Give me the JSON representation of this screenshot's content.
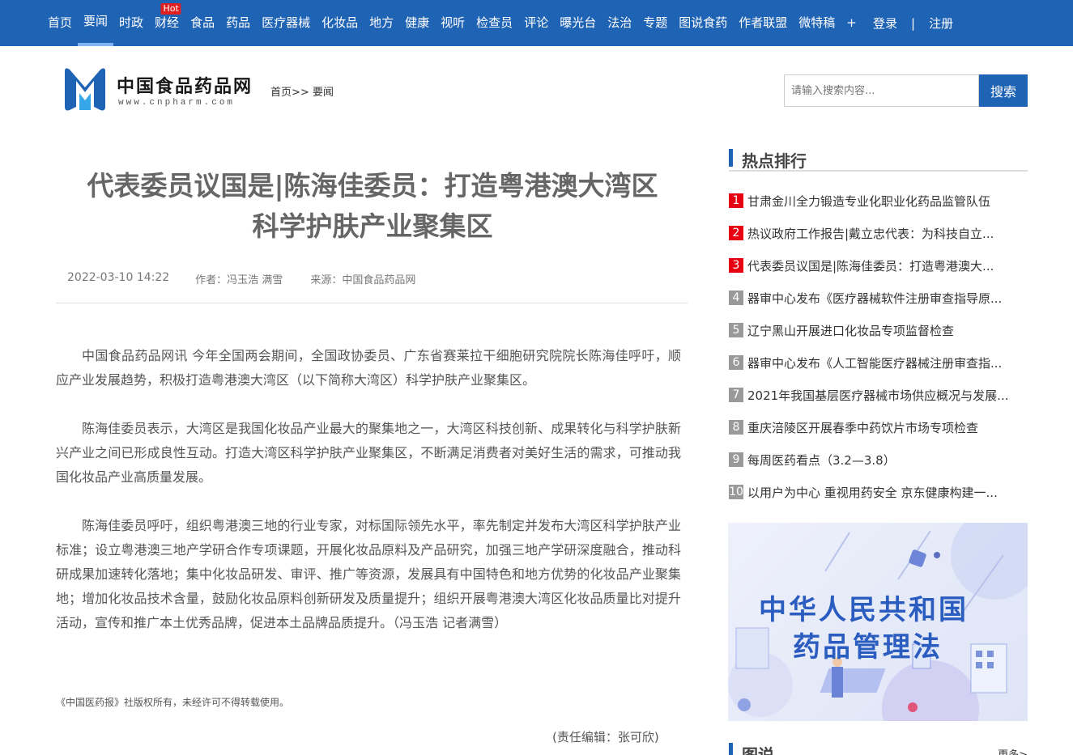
{
  "nav": {
    "items": [
      {
        "label": "首页"
      },
      {
        "label": "要闻"
      },
      {
        "label": "时政"
      },
      {
        "label": "财经"
      },
      {
        "label": "食品"
      },
      {
        "label": "药品"
      },
      {
        "label": "医疗器械"
      },
      {
        "label": "化妆品"
      },
      {
        "label": "地方"
      },
      {
        "label": "健康"
      },
      {
        "label": "视听"
      },
      {
        "label": "检查员"
      },
      {
        "label": "评论"
      },
      {
        "label": "曝光台"
      },
      {
        "label": "法治"
      },
      {
        "label": "专题"
      },
      {
        "label": "图说食药"
      },
      {
        "label": "作者联盟"
      },
      {
        "label": "微特稿"
      },
      {
        "label": "+"
      }
    ],
    "active_index": 1,
    "hot_badge": "Hot",
    "login": "登录",
    "separator": "|",
    "register": "注册"
  },
  "header": {
    "logo_text": "中国食品药品网",
    "logo_url": "www.cnpharm.com",
    "breadcrumb_home": "首页",
    "breadcrumb_sep": ">>",
    "breadcrumb_current": "要闻",
    "search_placeholder": "请输入搜索内容...",
    "search_button": "搜索"
  },
  "article": {
    "title_line1": "代表委员议国是|陈海佳委员：打造粤港澳大湾区",
    "title_line2": "科学护肤产业聚集区",
    "date": "2022-03-10 14:22",
    "author": "作者：冯玉浩 满雪",
    "source": "来源：中国食品药品网",
    "paragraphs": [
      "中国食品药品网讯 今年全国两会期间，全国政协委员、广东省赛莱拉干细胞研究院院长陈海佳呼吁，顺应产业发展趋势，积极打造粤港澳大湾区（以下简称大湾区）科学护肤产业聚集区。",
      "陈海佳委员表示，大湾区是我国化妆品产业最大的聚集地之一，大湾区科技创新、成果转化与科学护肤新兴产业之间已形成良性互动。打造大湾区科学护肤产业聚集区，不断满足消费者对美好生活的需求，可推动我国化妆品产业高质量发展。",
      "陈海佳委员呼吁，组织粤港澳三地的行业专家，对标国际领先水平，率先制定并发布大湾区科学护肤产业标准；设立粤港澳三地产学研合作专项课题，开展化妆品原料及产品研究，加强三地产学研深度融合，推动科研成果加速转化落地；集中化妆品研发、审评、推广等资源，发展具有中国特色和地方优势的化妆品产业聚集地；增加化妆品技术含量，鼓励化妆品原料创新研发及质量提升；组织开展粤港澳大湾区化妆品质量比对提升活动，宣传和推广本土优秀品牌，促进本土品牌品质提升。（冯玉浩 记者满雪）"
    ],
    "copyright": "《中国医药报》社版权所有，未经许可不得转载使用。",
    "editor": "(责任编辑：张可欣)"
  },
  "sidebar": {
    "hot_title": "热点排行",
    "hot_items": [
      {
        "num": "1",
        "text": "甘肃金川全力锻造专业化职业化药品监管队伍"
      },
      {
        "num": "2",
        "text": "热议政府工作报告|戴立忠代表：为科技自立..."
      },
      {
        "num": "3",
        "text": "代表委员议国是|陈海佳委员：打造粤港澳大..."
      },
      {
        "num": "4",
        "text": "器审中心发布《医疗器械软件注册审查指导原..."
      },
      {
        "num": "5",
        "text": "辽宁黑山开展进口化妆品专项监督检查"
      },
      {
        "num": "6",
        "text": "器审中心发布《人工智能医疗器械注册审查指..."
      },
      {
        "num": "7",
        "text": "2021年我国基层医疗器械市场供应概况与发展..."
      },
      {
        "num": "8",
        "text": "重庆涪陵区开展春季中药饮片市场专项检查"
      },
      {
        "num": "9",
        "text": "每周医药看点（3.2—3.8）"
      },
      {
        "num": "10",
        "text": "以用户为中心 重视用药安全 京东健康构建一..."
      }
    ],
    "banner_line1": "中华人民共和国",
    "banner_line2": "药品管理法",
    "section2_title": "图说",
    "section2_more": "更多>"
  },
  "colors": {
    "nav_bg": "#1f63b5",
    "accent": "#1f63b5",
    "hot_badge": "#e02020",
    "rank_top": "#e60012",
    "rank_rest": "#999999"
  }
}
